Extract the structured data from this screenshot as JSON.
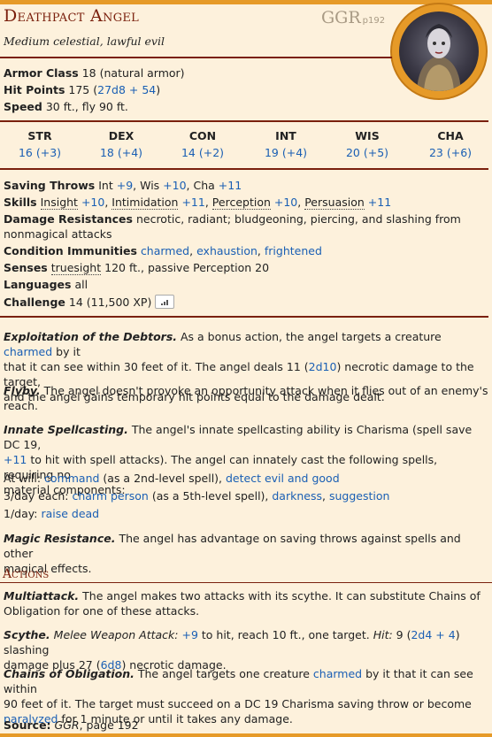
{
  "header": {
    "name": "Deathpact Angel",
    "source_abbrev": "GGR",
    "source_page": "p192",
    "subtitle": "Medium celestial, lawful evil"
  },
  "token_icon": "creature-portrait",
  "stats": {
    "ac_label": "Armor Class",
    "ac_value": "18 (natural armor)",
    "hp_label": "Hit Points",
    "hp_pre": "175 (",
    "hp_roll": "27d8 + 54",
    "hp_post": ")",
    "speed_label": "Speed",
    "speed_value": "30 ft., fly 90 ft."
  },
  "abilities": [
    {
      "label": "STR",
      "value": "16 (+3)"
    },
    {
      "label": "DEX",
      "value": "18 (+4)"
    },
    {
      "label": "CON",
      "value": "14 (+2)"
    },
    {
      "label": "INT",
      "value": "19 (+4)"
    },
    {
      "label": "WIS",
      "value": "20 (+5)"
    },
    {
      "label": "CHA",
      "value": "23 (+6)"
    }
  ],
  "saving_throws": {
    "label": "Saving Throws",
    "int": "Int ",
    "int_v": "+9",
    "wis": ", Wis ",
    "wis_v": "+10",
    "cha": ", Cha ",
    "cha_v": "+11"
  },
  "skills": {
    "label": "Skills",
    "insight": "Insight",
    "insight_v": "+10",
    "intim": "Intimidation",
    "intim_v": "+11",
    "perc": "Perception",
    "perc_v": "+10",
    "pers": "Persuasion",
    "pers_v": "+11"
  },
  "damage_res": {
    "label": "Damage Resistances",
    "line1": "necrotic, radiant; bludgeoning, piercing, and slashing from",
    "line2": "nonmagical attacks"
  },
  "cond_imm": {
    "label": "Condition Immunities",
    "c1": "charmed",
    "c2": "exhaustion",
    "c3": "frightened"
  },
  "senses": {
    "label": "Senses",
    "truesight": "truesight",
    "rest": "120 ft., passive Perception 20"
  },
  "languages": {
    "label": "Languages",
    "value": "all"
  },
  "challenge": {
    "label": "Challenge",
    "value": "14 (11,500 XP)",
    "button_icon": "signal-bars-icon"
  },
  "traits": {
    "exploit": {
      "name": "Exploitation of the Debtors.",
      "l1a": "As a bonus action, the angel targets a creature ",
      "l1b": "charmed",
      "l1c": " by it",
      "l2a": "that it can see within 30 feet of it. The angel deals 11 (",
      "l2b": "2d10",
      "l2c": ") necrotic damage to the target,",
      "l3": "and the angel gains temporary hit points equal to the damage dealt."
    },
    "flyby": {
      "name": "Flyby.",
      "l1": "The angel doesn't provoke an opportunity attack when it flies out of an enemy's",
      "l2": "reach."
    },
    "spell": {
      "name": "Innate Spellcasting.",
      "l1": "The angel's innate spellcasting ability is Charisma (spell save DC 19,",
      "l2a": "+11",
      "l2b": " to hit with spell attacks). The angel can innately cast the following spells, requiring no",
      "l3": "material components:",
      "w_pre": "At will: ",
      "w_s1": "command",
      "w_mid": " (as a 2nd-level spell), ",
      "w_s2": "detect evil and good",
      "d3_pre": "3/day each: ",
      "d3_s1": "charm person",
      "d3_mid": " (as a 5th-level spell), ",
      "d3_s2": "darkness",
      "d3_sep": ", ",
      "d3_s3": "suggestion",
      "d1_pre": "1/day: ",
      "d1_s1": "raise dead"
    },
    "magres": {
      "name": "Magic Resistance.",
      "l1": "The angel has advantage on saving throws against spells and other",
      "l2": "magical effects."
    }
  },
  "actions_header": "Actions",
  "actions": {
    "multi": {
      "name": "Multiattack.",
      "l1": "The angel makes two attacks with its scythe. It can substitute Chains of",
      "l2": "Obligation for one of these attacks."
    },
    "scythe": {
      "name": "Scythe.",
      "type": "Melee Weapon Attack:",
      "hit_bonus": "+9",
      "l1a": " to hit, reach 10 ft., one target. ",
      "hit_lbl": "Hit:",
      "l1b": " 9 (",
      "roll1": "2d4 + 4",
      "l1c": ") slashing",
      "l2a": "damage plus 27 (",
      "roll2": "6d8",
      "l2b": ") necrotic damage."
    },
    "chains": {
      "name": "Chains of Obligation.",
      "l1a": "The angel targets one creature ",
      "l1b": "charmed",
      "l1c": " by it that it can see within",
      "l2": "90 feet of it. The target must succeed on a DC 19 Charisma saving throw or become",
      "l3a": "paralyzed",
      "l3b": " for 1 minute or until it takes any damage."
    }
  },
  "source_line": {
    "label": "Source:",
    "book": "GGR",
    "rest": ", page 192"
  }
}
